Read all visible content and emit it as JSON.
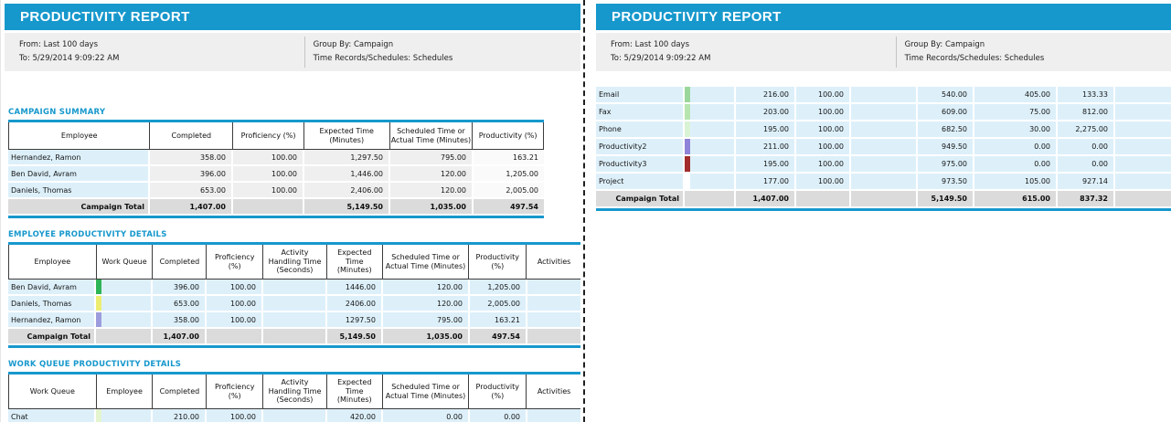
{
  "report": {
    "title": "PRODUCTIVITY REPORT",
    "info": {
      "from": "From: Last 100 days",
      "to": "To: 5/29/2014 9:09:22 AM",
      "group_by": "Group By: Campaign",
      "time_records": "Time Records/Schedules: Schedules"
    }
  },
  "colors": {
    "accent": "#1798CC",
    "row_blue": "#DDF0FA",
    "cell_grey": "#EFEFEF",
    "productivity_cell": "#FAFAFA",
    "total_grey": "#DBDBDB",
    "green_value": "#6F8F1F",
    "info_bg": "#EFEFEF"
  },
  "page1": {
    "campaign_summary": {
      "title": "CAMPAIGN SUMMARY",
      "columns": [
        "Employee",
        "Completed",
        "Proficiency (%)",
        "Expected Time (Minutes)",
        "Scheduled Time or Actual Time (Minutes)",
        "Productivity (%)"
      ],
      "rows": [
        {
          "label": "Hernandez, Ramon",
          "values": [
            "358.00",
            "100.00",
            "1,297.50",
            "795.00",
            "163.21"
          ]
        },
        {
          "label": "Ben David, Avram",
          "values": [
            "396.00",
            "100.00",
            "1,446.00",
            "120.00",
            "1,205.00"
          ]
        },
        {
          "label": "Daniels, Thomas",
          "values": [
            "653.00",
            "100.00",
            "2,406.00",
            "120.00",
            "2,005.00"
          ]
        }
      ],
      "total": {
        "label": "Campaign Total",
        "values": [
          "1,407.00",
          "",
          "5,149.50",
          "1,035.00",
          "497.54"
        ]
      }
    },
    "employee_details": {
      "title": "EMPLOYEE PRODUCTIVITY DETAILS",
      "columns": [
        "Employee",
        "Work Queue",
        "Completed",
        "Proficiency (%)",
        "Activity Handling Time (Seconds)",
        "Expected Time (Minutes)",
        "Scheduled Time or Actual Time (Minutes)",
        "Productivity (%)",
        "Activities"
      ],
      "rows": [
        {
          "label": "Ben David, Avram",
          "bar": "#2EB457",
          "values": [
            "",
            "396.00",
            "100.00",
            "",
            "1446.00",
            "120.00",
            "1,205.00",
            ""
          ]
        },
        {
          "label": "Daniels, Thomas",
          "bar": "#EDED72",
          "values": [
            "",
            "653.00",
            "100.00",
            "",
            "2406.00",
            "120.00",
            "2,005.00",
            ""
          ]
        },
        {
          "label": "Hernandez, Ramon",
          "bar": "#9D9DDE",
          "values": [
            "",
            "358.00",
            "100.00",
            "",
            "1297.50",
            "795.00",
            "163.21",
            ""
          ]
        }
      ],
      "total": {
        "label": "Campaign Total",
        "values": [
          "",
          "1,407.00",
          "",
          "",
          "5,149.50",
          "1,035.00",
          "497.54",
          ""
        ]
      }
    },
    "work_queue_details": {
      "title": "WORK QUEUE PRODUCTIVITY DETAILS",
      "columns": [
        "Work Queue",
        "Employee",
        "Completed",
        "Proficiency (%)",
        "Activity Handling Time (Seconds)",
        "Expected Time (Minutes)",
        "Scheduled Time or Actual Time (Minutes)",
        "Productivity (%)",
        "Activities"
      ],
      "rows": [
        {
          "label": "Chat",
          "bar": "#E4F4CF",
          "values": [
            "",
            "210.00",
            "100.00",
            "",
            "420.00",
            "0.00",
            "0.00",
            ""
          ]
        }
      ]
    }
  },
  "page2": {
    "work_queue_continued": {
      "rows": [
        {
          "label": "Email",
          "bar": "#9BD79B",
          "values": [
            "",
            "216.00",
            "100.00",
            "",
            "540.00",
            "405.00",
            "133.33",
            ""
          ]
        },
        {
          "label": "Fax",
          "bar": "#B7E5B0",
          "values": [
            "",
            "203.00",
            "100.00",
            "",
            "609.00",
            "75.00",
            "812.00",
            ""
          ]
        },
        {
          "label": "Phone",
          "bar": "#D9F3D5",
          "values": [
            "",
            "195.00",
            "100.00",
            "",
            "682.50",
            "30.00",
            "2,275.00",
            ""
          ]
        },
        {
          "label": "Productivity2",
          "bar": "#8E83D8",
          "values": [
            "",
            "211.00",
            "100.00",
            "",
            "949.50",
            "0.00",
            "0.00",
            ""
          ]
        },
        {
          "label": "Productivity3",
          "bar": "#A32C2C",
          "values": [
            "",
            "195.00",
            "100.00",
            "",
            "975.00",
            "0.00",
            "0.00",
            ""
          ]
        },
        {
          "label": "Project",
          "bar": "#FFFFFF",
          "values": [
            "",
            "177.00",
            "100.00",
            "",
            "973.50",
            "105.00",
            "927.14",
            ""
          ]
        }
      ],
      "total": {
        "label": "Campaign Total",
        "values": [
          "",
          "1,407.00",
          "",
          "",
          "5,149.50",
          "615.00",
          "837.32",
          ""
        ]
      }
    }
  }
}
